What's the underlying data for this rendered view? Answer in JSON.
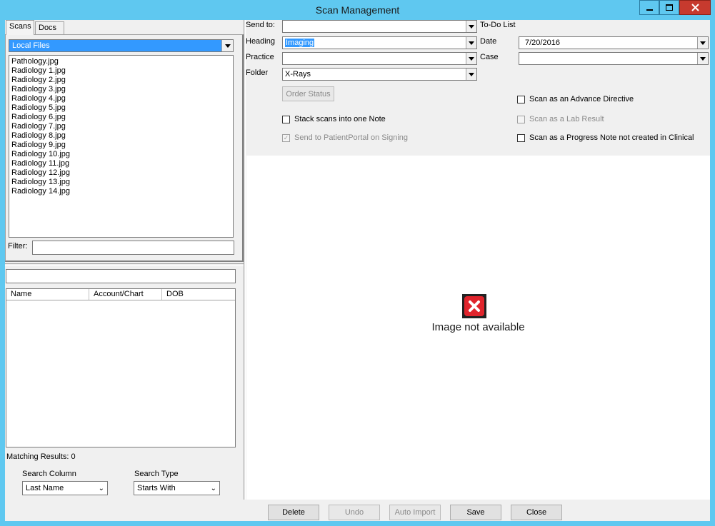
{
  "window": {
    "title": "Scan Management"
  },
  "left": {
    "tabs": [
      {
        "label": "Scans"
      },
      {
        "label": "Docs"
      }
    ],
    "source_combo": "Local Files",
    "files": [
      "Pathology.jpg",
      "Radiology 1.jpg",
      "Radiology 2.jpg",
      "Radiology 3.jpg",
      "Radiology 4.jpg",
      "Radiology 5.jpg",
      "Radiology 6.jpg",
      "Radiology 7.jpg",
      "Radiology 8.jpg",
      "Radiology 9.jpg",
      "Radiology 10.jpg",
      "Radiology 11.jpg",
      "Radiology 12.jpg",
      "Radiology 13.jpg",
      "Radiology 14.jpg"
    ],
    "filter_label": "Filter:",
    "filter_value": "",
    "search_value": "",
    "grid_columns": [
      {
        "label": "Name"
      },
      {
        "label": "Account/Chart"
      },
      {
        "label": "DOB"
      }
    ],
    "matching_results": "Matching Results: 0",
    "search_column_label": "Search Column",
    "search_column_value": "Last Name",
    "search_type_label": "Search Type",
    "search_type_value": "Starts With"
  },
  "form": {
    "send_to_label": "Send to:",
    "send_to_value": "",
    "todo_label": "To-Do List",
    "heading_label": "Heading",
    "heading_value": "Imaging",
    "date_label": "Date",
    "date_value": "7/20/2016",
    "practice_label": "Practice",
    "practice_value": "",
    "case_label": "Case",
    "case_value": "",
    "folder_label": "Folder",
    "folder_value": "X-Rays",
    "order_status_label": "Order Status",
    "checkboxes": {
      "advance_directive": {
        "label": "Scan as an Advance Directive",
        "checked": false
      },
      "stack_scans": {
        "label": "Stack scans into one Note",
        "checked": false
      },
      "lab_result": {
        "label": "Scan as a Lab Result",
        "checked": false
      },
      "patient_portal": {
        "label": "Send to PatientPortal on Signing",
        "checked": true
      },
      "progress_note": {
        "label": "Scan as a Progress Note not created in Clinical",
        "checked": false
      }
    }
  },
  "viewer": {
    "message": "Image not available"
  },
  "buttons": {
    "delete": "Delete",
    "undo": "Undo",
    "auto_import": "Auto Import",
    "save": "Save",
    "close": "Close"
  }
}
